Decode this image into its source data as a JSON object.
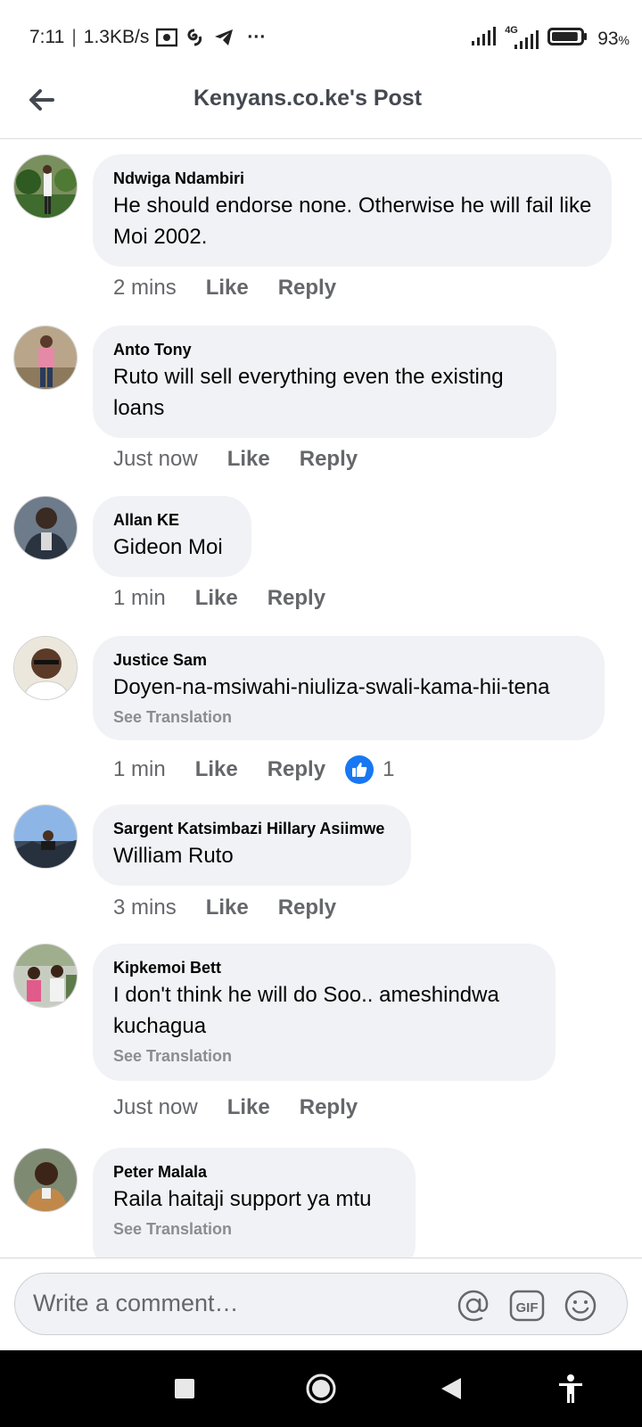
{
  "status_bar": {
    "time": "7:11",
    "speed": "1.3KB/s",
    "more": "···",
    "network": "4G",
    "battery": "93",
    "battery_unit": "%",
    "battery_level": 0.93
  },
  "header": {
    "title": "Kenyans.co.ke's Post"
  },
  "comments": [
    {
      "author": "Ndwiga Ndambiri",
      "text": "He should endorse none. Otherwise he will fail like Moi 2002.",
      "time": "2 mins",
      "like_label": "Like",
      "reply_label": "Reply"
    },
    {
      "author": "Anto Tony",
      "text": "Ruto will sell everything even the existing loans",
      "time": "Just now",
      "like_label": "Like",
      "reply_label": "Reply"
    },
    {
      "author": "Allan KE",
      "text": "Gideon Moi",
      "time": "1 min",
      "like_label": "Like",
      "reply_label": "Reply"
    },
    {
      "author": "Justice Sam",
      "text": "Doyen-na-msiwahi-niuliza-swali-kama-hii-tena",
      "see_translation": "See Translation",
      "time": "1 min",
      "like_label": "Like",
      "reply_label": "Reply",
      "reaction_count": "1"
    },
    {
      "author": "Sargent Katsimbazi Hillary Asiimwe",
      "text": "William Ruto",
      "time": "3 mins",
      "like_label": "Like",
      "reply_label": "Reply"
    },
    {
      "author": "Kipkemoi Bett",
      "text": "I don't think he will do Soo.. ameshindwa kuchagua",
      "see_translation": "See Translation",
      "time": "Just now",
      "like_label": "Like",
      "reply_label": "Reply"
    },
    {
      "author": "Peter Malala",
      "text": "Raila haitaji support ya mtu",
      "see_translation": "See Translation"
    }
  ],
  "composer": {
    "placeholder": "Write a comment…",
    "gif_label": "GIF"
  },
  "icons": {
    "back": "arrow-left-icon",
    "mention": "at-icon",
    "gif": "gif-icon",
    "emoji": "smiley-icon",
    "like_reaction": "thumbs-up-icon",
    "nav_recents": "square-icon",
    "nav_home": "circle-icon",
    "nav_back": "triangle-icon",
    "accessibility": "accessibility-icon"
  },
  "colors": {
    "bubble": "#f0f2f5",
    "secondary_text": "#65676b",
    "like_blue": "#1877f2"
  }
}
